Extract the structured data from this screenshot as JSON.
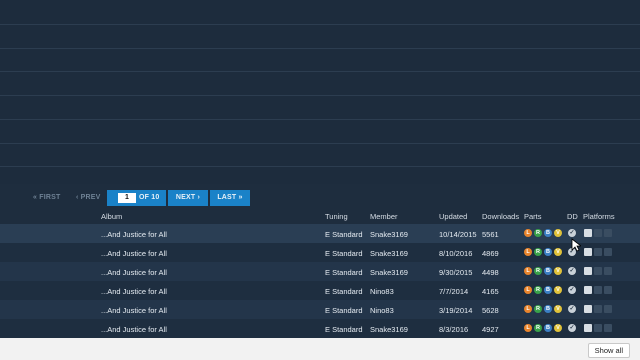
{
  "pager": {
    "first": "« FIRST",
    "prev": "‹ PREV",
    "page_value": "1",
    "of_label": "OF 10",
    "next": "NEXT ›",
    "last": "LAST »"
  },
  "table": {
    "headers": {
      "album": "Album",
      "tuning": "Tuning",
      "member": "Member",
      "updated": "Updated",
      "downloads": "Downloads",
      "parts": "Parts",
      "dd": "DD",
      "platforms": "Platforms"
    },
    "rows": [
      {
        "album": "...And Justice for All",
        "tuning": "E Standard",
        "member": "Snake3169",
        "updated": "10/14/2015",
        "downloads": "5561"
      },
      {
        "album": "...And Justice for All",
        "tuning": "E Standard",
        "member": "Snake3169",
        "updated": "8/10/2016",
        "downloads": "4869"
      },
      {
        "album": "...And Justice for All",
        "tuning": "E Standard",
        "member": "Snake3169",
        "updated": "9/30/2015",
        "downloads": "4498"
      },
      {
        "album": "...And Justice for All",
        "tuning": "E Standard",
        "member": "Nino83",
        "updated": "7/7/2014",
        "downloads": "4165"
      },
      {
        "album": "...And Justice for All",
        "tuning": "E Standard",
        "member": "Nino83",
        "updated": "3/19/2014",
        "downloads": "5628"
      },
      {
        "album": "...And Justice for All",
        "tuning": "E Standard",
        "member": "Snake3169",
        "updated": "8/3/2016",
        "downloads": "4927"
      }
    ],
    "part_letters": [
      "L",
      "R",
      "B",
      "V"
    ],
    "part_colors": {
      "L": "#e8842c",
      "R": "#39a24a",
      "B": "#3b7fc4",
      "V": "#e0c23a"
    },
    "dd_symbol": "✓"
  },
  "footer": {
    "show_all": "Show all"
  }
}
